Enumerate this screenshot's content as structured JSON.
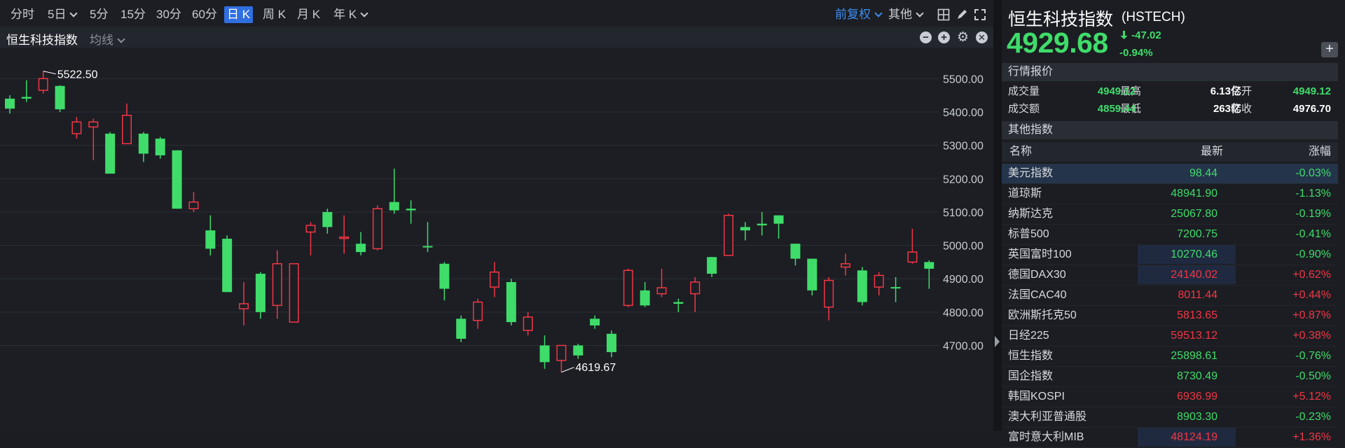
{
  "toolbar": {
    "timeframes": [
      "分时",
      "5日",
      "5分",
      "15分",
      "30分",
      "60分",
      "日 K",
      "周 K",
      "月 K",
      "年 K"
    ],
    "active": "日 K",
    "fuquan_label": "前复权",
    "other_label": "其他"
  },
  "chart": {
    "title": "恒生科技指数",
    "ma_label": "均线",
    "high_marker": "5522.50",
    "low_marker": "4619.67",
    "colors": {
      "up": "#f23645",
      "down": "#3fdc6a",
      "bg": "#1c1e24",
      "grid": "#2c2f36"
    }
  },
  "chart_data": {
    "type": "candlestick",
    "y_ticks": [
      "5500.00",
      "5400.00",
      "5300.00",
      "5200.00",
      "5100.00",
      "5000.00",
      "4900.00",
      "4800.00",
      "4700.00"
    ],
    "ylim": [
      4619.67,
      5522.5
    ],
    "candles": [
      {
        "o": 5440,
        "c": 5410,
        "h": 5450,
        "l": 5395
      },
      {
        "o": 5445,
        "c": 5440,
        "h": 5495,
        "l": 5430
      },
      {
        "o": 5465,
        "c": 5500,
        "h": 5522.5,
        "l": 5455
      },
      {
        "o": 5478,
        "c": 5408,
        "h": 5480,
        "l": 5400
      },
      {
        "o": 5335,
        "c": 5370,
        "h": 5385,
        "l": 5320
      },
      {
        "o": 5355,
        "c": 5370,
        "h": 5380,
        "l": 5255
      },
      {
        "o": 5335,
        "c": 5215,
        "h": 5340,
        "l": 5215
      },
      {
        "o": 5305,
        "c": 5390,
        "h": 5425,
        "l": 5305
      },
      {
        "o": 5335,
        "c": 5275,
        "h": 5340,
        "l": 5250
      },
      {
        "o": 5320,
        "c": 5270,
        "h": 5325,
        "l": 5260
      },
      {
        "o": 5285,
        "c": 5110,
        "h": 5285,
        "l": 5110
      },
      {
        "o": 5110,
        "c": 5130,
        "h": 5160,
        "l": 5100
      },
      {
        "o": 5045,
        "c": 4990,
        "h": 5090,
        "l": 4970
      },
      {
        "o": 5020,
        "c": 4860,
        "h": 5030,
        "l": 4860
      },
      {
        "o": 4810,
        "c": 4825,
        "h": 4890,
        "l": 4760
      },
      {
        "o": 4915,
        "c": 4800,
        "h": 4920,
        "l": 4780
      },
      {
        "o": 4820,
        "c": 4945,
        "h": 4985,
        "l": 4780
      },
      {
        "o": 4770,
        "c": 4945,
        "h": 4945,
        "l": 4770
      },
      {
        "o": 5040,
        "c": 5060,
        "h": 5070,
        "l": 4970
      },
      {
        "o": 5100,
        "c": 5055,
        "h": 5110,
        "l": 5035
      },
      {
        "o": 5025,
        "c": 5025,
        "h": 5090,
        "l": 4975
      },
      {
        "o": 5005,
        "c": 4980,
        "h": 5040,
        "l": 4970
      },
      {
        "o": 4990,
        "c": 5110,
        "h": 5120,
        "l": 4985
      },
      {
        "o": 5130,
        "c": 5105,
        "h": 5230,
        "l": 5095
      },
      {
        "o": 5110,
        "c": 5105,
        "h": 5135,
        "l": 5065
      },
      {
        "o": 4998,
        "c": 4996,
        "h": 5070,
        "l": 4980
      },
      {
        "o": 4945,
        "c": 4870,
        "h": 4950,
        "l": 4835
      },
      {
        "o": 4780,
        "c": 4720,
        "h": 4790,
        "l": 4710
      },
      {
        "o": 4775,
        "c": 4830,
        "h": 4840,
        "l": 4750
      },
      {
        "o": 4875,
        "c": 4920,
        "h": 4950,
        "l": 4845
      },
      {
        "o": 4890,
        "c": 4770,
        "h": 4900,
        "l": 4760
      },
      {
        "o": 4745,
        "c": 4785,
        "h": 4800,
        "l": 4730
      },
      {
        "o": 4700,
        "c": 4650,
        "h": 4730,
        "l": 4630
      },
      {
        "o": 4655,
        "c": 4700,
        "h": 4700,
        "l": 4619.67
      },
      {
        "o": 4700,
        "c": 4670,
        "h": 4705,
        "l": 4660
      },
      {
        "o": 4780,
        "c": 4760,
        "h": 4790,
        "l": 4750
      },
      {
        "o": 4735,
        "c": 4680,
        "h": 4745,
        "l": 4665
      },
      {
        "o": 4820,
        "c": 4925,
        "h": 4930,
        "l": 4815
      },
      {
        "o": 4865,
        "c": 4820,
        "h": 4890,
        "l": 4815
      },
      {
        "o": 4855,
        "c": 4873,
        "h": 4930,
        "l": 4845
      },
      {
        "o": 4830,
        "c": 4825,
        "h": 4840,
        "l": 4800
      },
      {
        "o": 4855,
        "c": 4890,
        "h": 4905,
        "l": 4800
      },
      {
        "o": 4965,
        "c": 4915,
        "h": 4965,
        "l": 4905
      },
      {
        "o": 4970,
        "c": 5090,
        "h": 5095,
        "l": 4970
      },
      {
        "o": 5055,
        "c": 5045,
        "h": 5070,
        "l": 5015
      },
      {
        "o": 5065,
        "c": 5060,
        "h": 5100,
        "l": 5030
      },
      {
        "o": 5090,
        "c": 5065,
        "h": 5090,
        "l": 5020
      },
      {
        "o": 5005,
        "c": 4960,
        "h": 5005,
        "l": 4940
      },
      {
        "o": 4960,
        "c": 4865,
        "h": 4960,
        "l": 4850
      },
      {
        "o": 4815,
        "c": 4895,
        "h": 4905,
        "l": 4775
      },
      {
        "o": 4935,
        "c": 4945,
        "h": 4975,
        "l": 4910
      },
      {
        "o": 4925,
        "c": 4830,
        "h": 4935,
        "l": 4820
      },
      {
        "o": 4875,
        "c": 4910,
        "h": 4920,
        "l": 4850
      },
      {
        "o": 4875,
        "c": 4873,
        "h": 4905,
        "l": 4830
      },
      {
        "o": 4950,
        "c": 4980,
        "h": 5050,
        "l": 4945
      },
      {
        "o": 4950,
        "c": 4930,
        "h": 4955,
        "l": 4870
      }
    ]
  },
  "quote": {
    "name": "恒生科技指数",
    "code": "(HSTECH)",
    "price": "4929.68",
    "change": "-47.02",
    "change_pct": "-0.94%",
    "add_label": "+"
  },
  "market": {
    "section_label": "行情报价",
    "fields": [
      {
        "label": "成交量",
        "value": "6.13亿",
        "color": "#ffffff"
      },
      {
        "label": "最高",
        "value": "4949.12",
        "color": "#3fdc6a"
      },
      {
        "label": "今开",
        "value": "4949.12",
        "color": "#3fdc6a"
      },
      {
        "label": "成交额",
        "value": "263亿",
        "color": "#ffffff"
      },
      {
        "label": "最低",
        "value": "4859.44",
        "color": "#3fdc6a"
      },
      {
        "label": "昨收",
        "value": "4976.70",
        "color": "#ffffff"
      }
    ]
  },
  "others": {
    "section_label": "其他指数",
    "columns": [
      "名称",
      "最新",
      "涨幅"
    ],
    "rows": [
      {
        "name": "美元指数",
        "price": "98.44",
        "pct": "-0.03%",
        "dir": "down",
        "selected": true
      },
      {
        "name": "道琼斯",
        "price": "48941.90",
        "pct": "-1.13%",
        "dir": "down"
      },
      {
        "name": "纳斯达克",
        "price": "25067.80",
        "pct": "-0.19%",
        "dir": "down"
      },
      {
        "name": "标普500",
        "price": "7200.75",
        "pct": "-0.41%",
        "dir": "down"
      },
      {
        "name": "英国富时100",
        "price": "10270.46",
        "pct": "-0.90%",
        "dir": "down",
        "hl": true
      },
      {
        "name": "德国DAX30",
        "price": "24140.02",
        "pct": "+0.62%",
        "dir": "up",
        "hl": true
      },
      {
        "name": "法国CAC40",
        "price": "8011.44",
        "pct": "+0.44%",
        "dir": "up"
      },
      {
        "name": "欧洲斯托克50",
        "price": "5813.65",
        "pct": "+0.87%",
        "dir": "up"
      },
      {
        "name": "日经225",
        "price": "59513.12",
        "pct": "+0.38%",
        "dir": "up"
      },
      {
        "name": "恒生指数",
        "price": "25898.61",
        "pct": "-0.76%",
        "dir": "down"
      },
      {
        "name": "国企指数",
        "price": "8730.49",
        "pct": "-0.50%",
        "dir": "down"
      },
      {
        "name": "韩国KOSPI",
        "price": "6936.99",
        "pct": "+5.12%",
        "dir": "up"
      },
      {
        "name": "澳大利亚普通股",
        "price": "8903.30",
        "pct": "-0.23%",
        "dir": "down"
      },
      {
        "name": "富时意大利MIB",
        "price": "48124.19",
        "pct": "+1.36%",
        "dir": "up",
        "hl": true
      }
    ]
  }
}
